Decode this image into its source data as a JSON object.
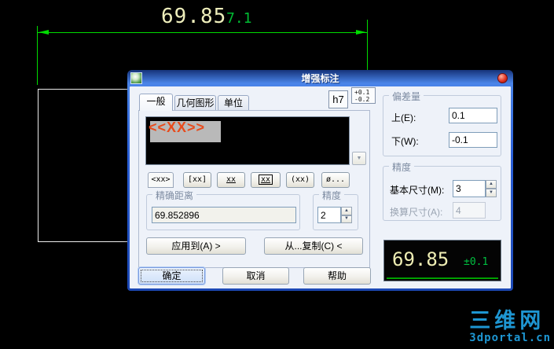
{
  "canvas": {
    "dimension_value": "69.85",
    "dimension_tolerance": "7.1",
    "line_color": "#00dd00",
    "dim_text_color": "#eeeebb"
  },
  "watermark": {
    "title": "三维网",
    "url": "3dportal.cn",
    "color": "#1e96d2"
  },
  "dialog": {
    "title": "增强标注",
    "tabs": [
      {
        "label": "一般"
      },
      {
        "label": "几何图形"
      },
      {
        "label": "单位"
      }
    ],
    "fit_tolerance_button": "h7",
    "tolerance_badge": {
      "upper": "+0.1",
      "lower": "-0.2"
    },
    "preview": {
      "selected_text": "<<XX>>",
      "text_color": "#e84b1c"
    },
    "scroll_down_glyph": "▼",
    "format_buttons": [
      {
        "label": "<xx>"
      },
      {
        "label": "[xx]"
      },
      {
        "label": "xx"
      },
      {
        "label": "xx"
      },
      {
        "label": "(xx)"
      },
      {
        "label": "ø..."
      }
    ],
    "exact_distance_group": {
      "label": "精确距离",
      "value": "69.852896"
    },
    "precision_spinner_group": {
      "label": "精度",
      "value": "2"
    },
    "apply_button": "应用到(A) >",
    "copy_from_button": "从...复制(C) <",
    "deviation_group": {
      "label": "偏差量",
      "upper_label": "上(E):",
      "upper_value": "0.1",
      "lower_label": "下(W):",
      "lower_value": "-0.1"
    },
    "precision_group": {
      "label": "精度",
      "basic_size_label": "基本尺寸(M):",
      "basic_size_value": "3",
      "converted_size_label": "换算尺寸(A):",
      "converted_size_value": "4"
    },
    "result_preview": {
      "value": "69.85",
      "tolerance": "±0.1"
    },
    "ok_button": "确定",
    "cancel_button": "取消",
    "help_button": "帮助",
    "spin_up_glyph": "▲",
    "spin_down_glyph": "▼"
  }
}
